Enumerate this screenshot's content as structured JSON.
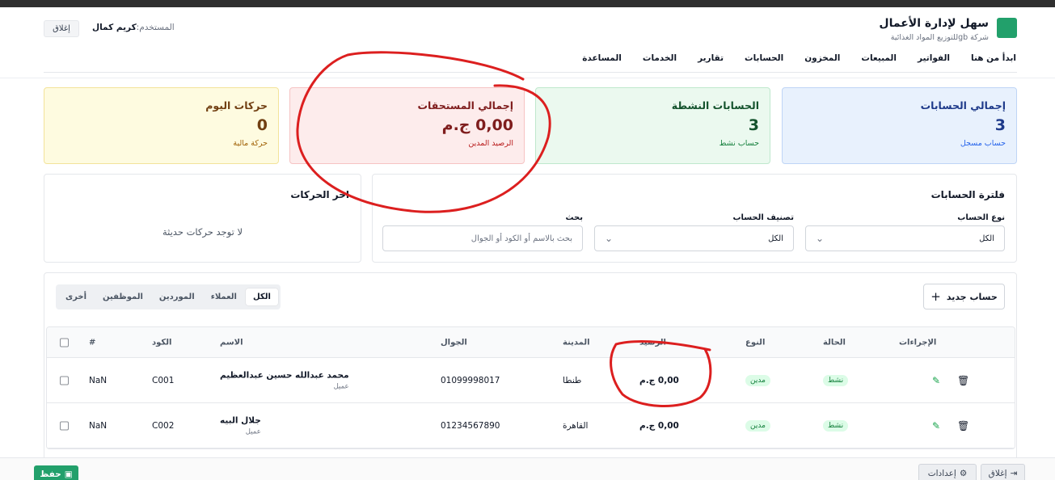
{
  "app": {
    "title": "سهل لإدارة الأعمال",
    "company": "شركة gbللتوزيع المواد الغذائية",
    "user_label": "المستخدم:",
    "user_name": "كريم كمال",
    "close_label": "إغلاق"
  },
  "nav": {
    "items": [
      "ابدأ من هنا",
      "الفواتير",
      "المبيعات",
      "المخزون",
      "الحسابات",
      "تقارير",
      "الخدمات",
      "المساعدة"
    ]
  },
  "stats": [
    {
      "title": "إجمالي الحسابات",
      "value": "3",
      "sub": "حساب مسجل"
    },
    {
      "title": "الحسابات النشطة",
      "value": "3",
      "sub": "حساب نشط"
    },
    {
      "title": "إجمالي المستحقات",
      "value": "0,00 ج.م",
      "sub": "الرصيد المدين"
    },
    {
      "title": "حركات اليوم",
      "value": "0",
      "sub": "حركة مالية"
    }
  ],
  "filter": {
    "title": "فلترة الحسابات",
    "account_type_label": "نوع الحساب",
    "account_type_value": "الكل",
    "category_label": "تصنيف الحساب",
    "category_value": "الكل",
    "search_label": "بحث",
    "search_placeholder": "بحث بالاسم أو الكود أو الجوال"
  },
  "recent": {
    "title": "اخر الحركات",
    "empty": "لا توجد حركات حديثة"
  },
  "accounts": {
    "new_button": "حساب جديد",
    "tabs": [
      "الكل",
      "العملاء",
      "الموردين",
      "الموظفين",
      "أخرى"
    ],
    "active_tab": "الكل",
    "columns": {
      "hash": "#",
      "code": "الكود",
      "name": "الاسم",
      "phone": "الجوال",
      "city": "المدينة",
      "balance": "الرصيد",
      "type": "النوع",
      "status": "الحالة",
      "actions": "الإجراءات"
    },
    "rows": [
      {
        "num": "NaN",
        "code": "C001",
        "name": "محمد عبدالله حسين عبدالعظيم",
        "role": "عميل",
        "phone": "01099998017",
        "city": "طنطا",
        "balance": "0,00 ج.م",
        "type": "مدين",
        "status": "نشط"
      },
      {
        "num": "NaN",
        "code": "C002",
        "name": "جلال البيه",
        "role": "عميل",
        "phone": "01234567890",
        "city": "القاهرة",
        "balance": "0,00 ج.م",
        "type": "مدين",
        "status": "نشط"
      }
    ]
  },
  "footer": {
    "save": "حفظ",
    "settings": "إعدادات",
    "close": "إغلاق"
  },
  "colors": {
    "brand": "#22a06b",
    "annotation": "#dc1f1f"
  }
}
